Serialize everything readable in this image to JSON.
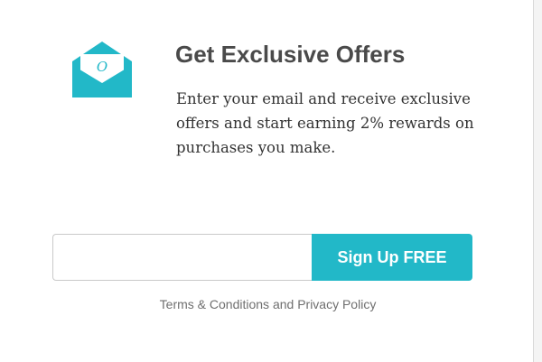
{
  "offer": {
    "title": "Get Exclusive Offers",
    "description": "Enter your email and receive exclusive offers and start earning 2% rewards on purchases you make.",
    "icon": "envelope-icon",
    "icon_letter": "O"
  },
  "form": {
    "email_value": "",
    "email_placeholder": "",
    "button_label": "Sign Up FREE"
  },
  "legal": {
    "terms_label": "Terms & Conditions",
    "separator": "and",
    "privacy_label": "Privacy Policy"
  },
  "colors": {
    "accent": "#22b8c8",
    "title_text": "#4a4a4a",
    "body_text": "#333333",
    "legal_text": "#6f6f6f"
  }
}
